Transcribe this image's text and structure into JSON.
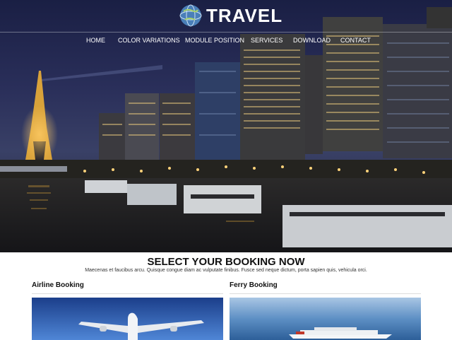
{
  "brand": {
    "name": "TRAVEL"
  },
  "nav": {
    "items": [
      {
        "label": "HOME"
      },
      {
        "label": "COLOR VARIATIONS"
      },
      {
        "label": "MODULE POSITION"
      },
      {
        "label": "SERVICES"
      },
      {
        "label": "DOWNLOAD"
      },
      {
        "label": "CONTACT"
      }
    ]
  },
  "booking": {
    "title": "SELECT YOUR BOOKING NOW",
    "subtitle": "Maecenas et faucibus arcu. Quisque congue diam ac vulputate finibus. Fusce sed neque dictum, porta sapien quis, vehicula orci.",
    "cards": [
      {
        "title": "Airline Booking",
        "image": "airplane-photo"
      },
      {
        "title": "Ferry Booking",
        "image": "ferry-photo"
      }
    ]
  },
  "colors": {
    "hero_sky": "#1a1f44",
    "text_dark": "#111111"
  },
  "icons": {
    "logo": "globe-icon"
  }
}
